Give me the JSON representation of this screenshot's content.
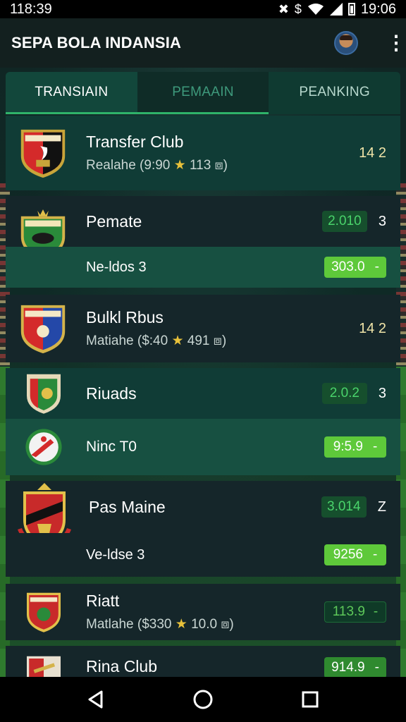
{
  "status": {
    "time_left": "118:39",
    "time_right": "19:06",
    "icons": [
      "close-icon",
      "dollar-icon",
      "wifi-icon",
      "signal-icon",
      "battery-icon"
    ]
  },
  "app": {
    "title": "SEPA BOLA INDANSIA"
  },
  "tabs": [
    {
      "label": "TRANSIAIN"
    },
    {
      "label": "PEMAAIN"
    },
    {
      "label": "PEANKING"
    }
  ],
  "rows": [
    {
      "name": "Transfer Club",
      "sub_a": "Realahe (9:90",
      "sub_star": "★",
      "sub_b": "113",
      "sub_c": "⧈)",
      "score": "14 2"
    },
    {
      "name": "Pemate",
      "pill": "2.010",
      "num": "3"
    },
    {
      "name": "Ne-ldos 3",
      "pill": "303.0",
      "dash": "-"
    },
    {
      "name": "Bulkl Rbus",
      "sub_a": "Matiahe ($:40",
      "sub_star": "★",
      "sub_b": "491",
      "sub_c": "⧈)",
      "score": "14 2"
    },
    {
      "name": "Riuads",
      "pill": "2.0.2",
      "num": "3"
    },
    {
      "name": "Ninc T0",
      "pill": "9:5.9",
      "dash": "-"
    },
    {
      "name": "Pas Maine",
      "pill": "3.014",
      "num": "Z"
    },
    {
      "name": "Ve-ldse 3",
      "pill": "9256",
      "dash": "-"
    },
    {
      "name": "Riatt",
      "sub_a": "Matlahe ($330",
      "sub_star": "★",
      "sub_b": "10.0",
      "sub_c": "⧈)",
      "pill": "113.9",
      "dash": "-"
    },
    {
      "name": "Rina Club",
      "pill": "914.9",
      "dash": "-"
    }
  ],
  "colors": {
    "accent": "#2fb36a",
    "pill_bright": "#5ec93a",
    "score_gold": "#f0e4a8"
  }
}
